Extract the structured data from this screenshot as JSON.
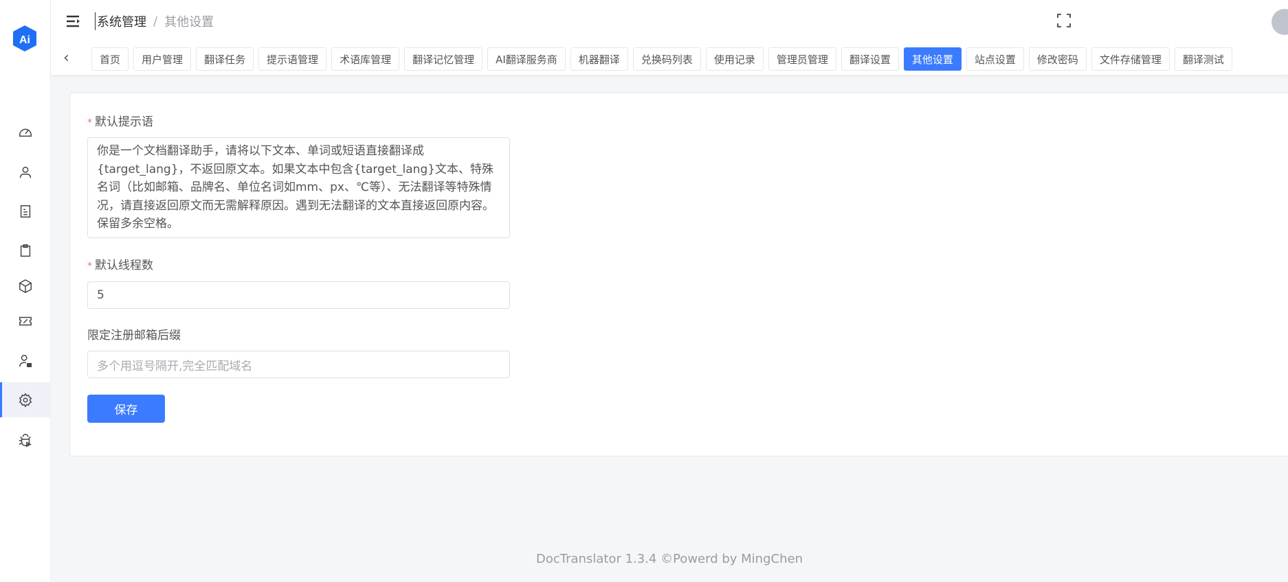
{
  "logo_text": "Ai",
  "breadcrumb": {
    "parent": "系统管理",
    "separator": "/",
    "current": "其他设置"
  },
  "tabs": [
    "首页",
    "用户管理",
    "翻译任务",
    "提示语管理",
    "术语库管理",
    "翻译记忆管理",
    "AI翻译服务商",
    "机器翻译",
    "兑换码列表",
    "使用记录",
    "管理员管理",
    "翻译设置",
    "其他设置",
    "站点设置",
    "修改密码",
    "文件存储管理",
    "翻译测试"
  ],
  "active_tab": "其他设置",
  "form": {
    "prompt_label": "默认提示语",
    "prompt_value": "你是一个文档翻译助手，请将以下文本、单词或短语直接翻译成{target_lang}，不返回原文本。如果文本中包含{target_lang}文本、特殊名词（比如邮箱、品牌名、单位名词如mm、px、℃等）、无法翻译等特殊情况，请直接返回原文而无需解释原因。遇到无法翻译的文本直接返回原内容。保留多余空格。",
    "threads_label": "默认线程数",
    "threads_value": "5",
    "email_label": "限定注册邮箱后缀",
    "email_placeholder": "多个用逗号隔开,完全匹配域名",
    "required_mark": "*",
    "save_label": "保存"
  },
  "footer": "DocTranslator 1.3.4 ©Powerd by MingChen",
  "colors": {
    "accent": "#3a7bff"
  }
}
